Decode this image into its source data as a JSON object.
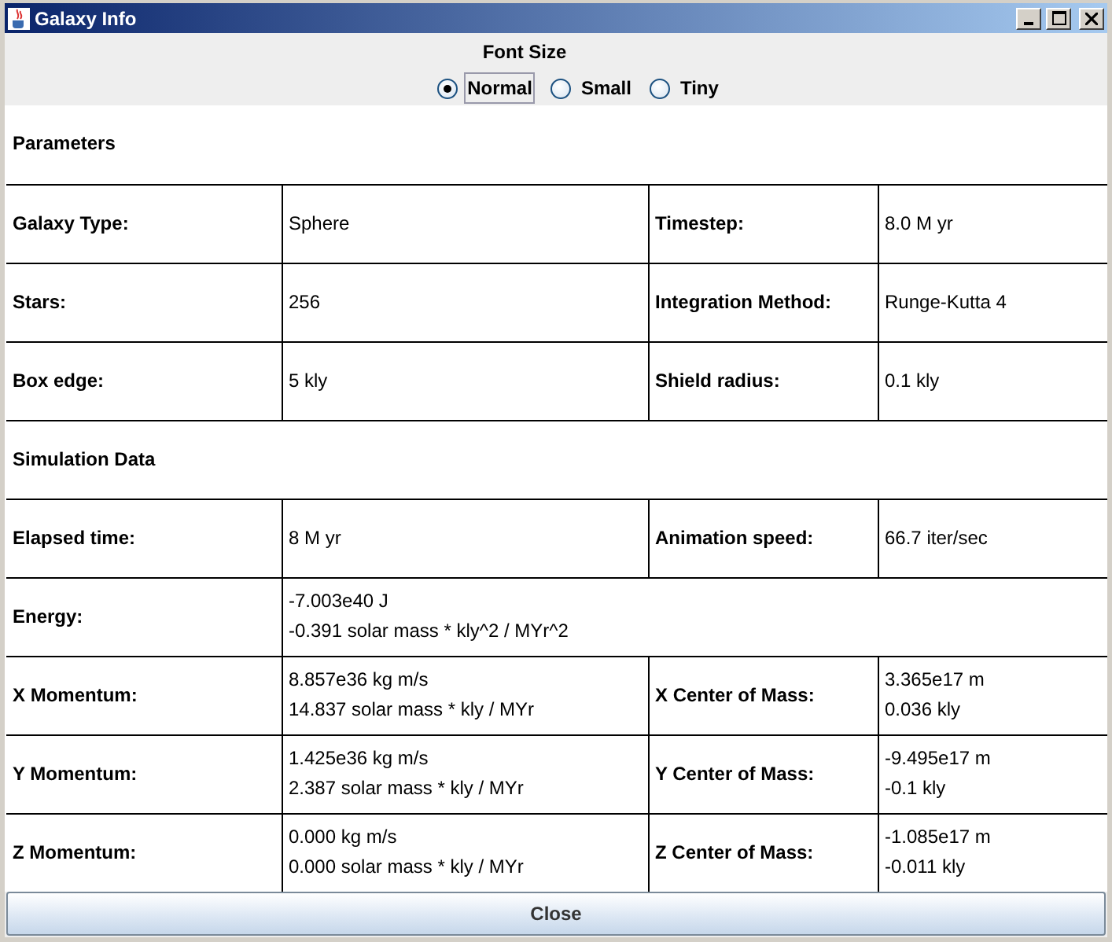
{
  "window": {
    "title": "Galaxy Info"
  },
  "font_size": {
    "label": "Font Size",
    "options": [
      {
        "label": "Normal",
        "selected": true
      },
      {
        "label": "Small",
        "selected": false
      },
      {
        "label": "Tiny",
        "selected": false
      }
    ]
  },
  "sections": [
    {
      "title": "Parameters",
      "rows": [
        {
          "cells": [
            {
              "label": "Galaxy Type:",
              "value": [
                "Sphere"
              ]
            },
            {
              "label": "Timestep:",
              "value": [
                "8.0 M yr"
              ]
            }
          ]
        },
        {
          "cells": [
            {
              "label": "Stars:",
              "value": [
                "256"
              ]
            },
            {
              "label": "Integration Method:",
              "value": [
                "Runge-Kutta 4"
              ]
            }
          ]
        },
        {
          "cells": [
            {
              "label": "Box edge:",
              "value": [
                "5 kly"
              ]
            },
            {
              "label": "Shield radius:",
              "value": [
                "0.1 kly"
              ]
            }
          ]
        }
      ]
    },
    {
      "title": "Simulation Data",
      "rows": [
        {
          "cells": [
            {
              "label": "Elapsed time:",
              "value": [
                "8 M yr"
              ]
            },
            {
              "label": "Animation speed:",
              "value": [
                "66.7 iter/sec"
              ]
            }
          ]
        },
        {
          "cells": [
            {
              "label": "Energy:",
              "value": [
                "-7.003e40 J",
                "-0.391 solar mass * kly^2 / MYr^2"
              ]
            }
          ]
        },
        {
          "cells": [
            {
              "label": "X Momentum:",
              "value": [
                "8.857e36 kg m/s",
                "14.837 solar mass * kly / MYr"
              ]
            },
            {
              "label": "X Center of Mass:",
              "value": [
                "3.365e17 m",
                "0.036 kly"
              ]
            }
          ]
        },
        {
          "cells": [
            {
              "label": "Y Momentum:",
              "value": [
                "1.425e36 kg m/s",
                "2.387 solar mass * kly / MYr"
              ]
            },
            {
              "label": "Y Center of Mass:",
              "value": [
                "-9.495e17 m",
                "-0.1 kly"
              ]
            }
          ]
        },
        {
          "cells": [
            {
              "label": "Z Momentum:",
              "value": [
                "0.000 kg m/s",
                "0.000 solar mass * kly / MYr"
              ]
            },
            {
              "label": "Z Center of Mass:",
              "value": [
                "-1.085e17 m",
                "-0.011 kly"
              ]
            }
          ]
        }
      ]
    }
  ],
  "close_button": "Close"
}
